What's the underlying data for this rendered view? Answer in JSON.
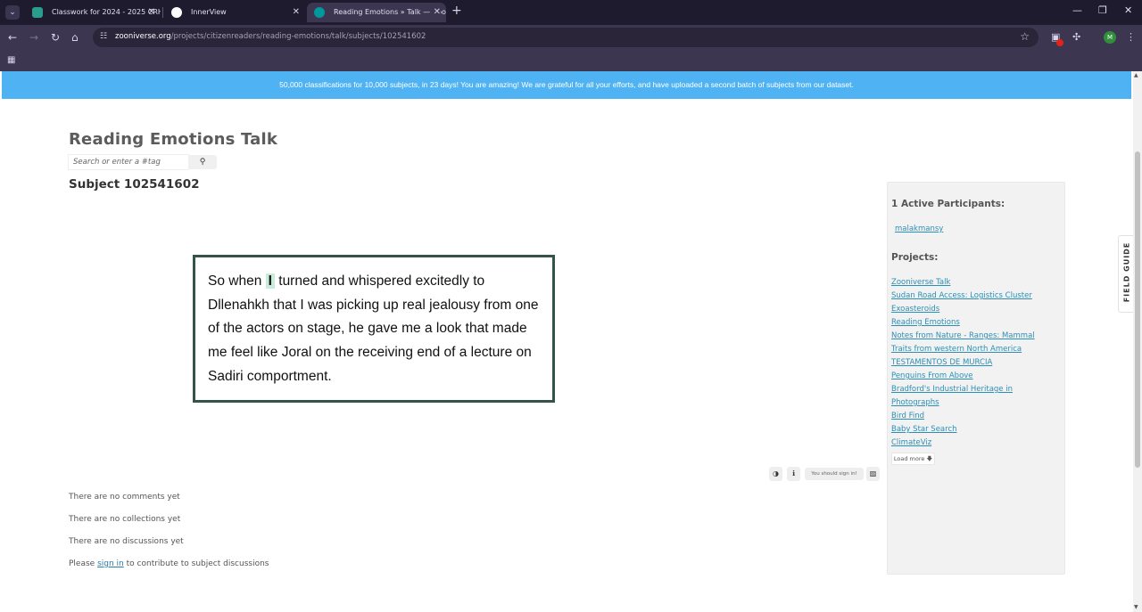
{
  "browser": {
    "tabs": [
      {
        "title": "Classwork for 2024 - 2025 CRH",
        "favicon_color": "#2a9d8f"
      },
      {
        "title": "InnerView",
        "favicon_color": "#ffffff"
      },
      {
        "title": "Reading Emotions » Talk — Zoo",
        "favicon_color": "#00979d"
      }
    ],
    "new_tab": "+",
    "url_host": "zooniverse.org",
    "url_path": "/projects/citizenreaders/reading-emotions/talk/subjects/102541602",
    "profile_initial": "M"
  },
  "banner": {
    "text": "50,000 classifications for 10,000 subjects, in 23 days! You are amazing! We are grateful for all your efforts, and have uploaded a second batch of subjects from our dataset."
  },
  "talk": {
    "title": "Reading Emotions Talk",
    "search_placeholder": "Search or enter a #tag",
    "subject_heading": "Subject 102541602"
  },
  "subject": {
    "before": "So when ",
    "highlight": "I",
    "after": " turned and whispered excitedly to Dllenahkh that I was picking up real jealousy from one of the actors on stage, he gave me a look that made me feel like Joral on the receiving end of a lecture on Sadiri comportment."
  },
  "tools": {
    "signin_hint": "You should sign in!"
  },
  "discussion": {
    "comments": "There are no comments yet",
    "collections": "There are no collections yet",
    "discussions": "There are no discussions yet",
    "please": "Please",
    "sign_in": "sign in",
    "contribute": "to contribute to subject discussions"
  },
  "sidebar": {
    "participants_heading": "1 Active Participants:",
    "participants": [
      "malakmansy"
    ],
    "projects_heading": "Projects:",
    "projects": [
      "Zooniverse Talk",
      "Sudan Road Access: Logistics Cluster",
      "Exoasteroids",
      "Reading Emotions",
      "Notes from Nature - Ranges: Mammal",
      "Traits from western North America",
      "TESTAMENTOS DE MURCIA",
      "Penguins From Above",
      "Bradford's Industrial Heritage in",
      "Photographs",
      "Bird Find",
      "Baby Star Search",
      "ClimateViz"
    ],
    "load_more": "Load more"
  },
  "field_guide": "FIELD GUIDE",
  "colors": {
    "banner": "#4fb3f3",
    "link": "#2b8fb5",
    "card_border": "#345447",
    "highlight": "#c8ecd9"
  }
}
